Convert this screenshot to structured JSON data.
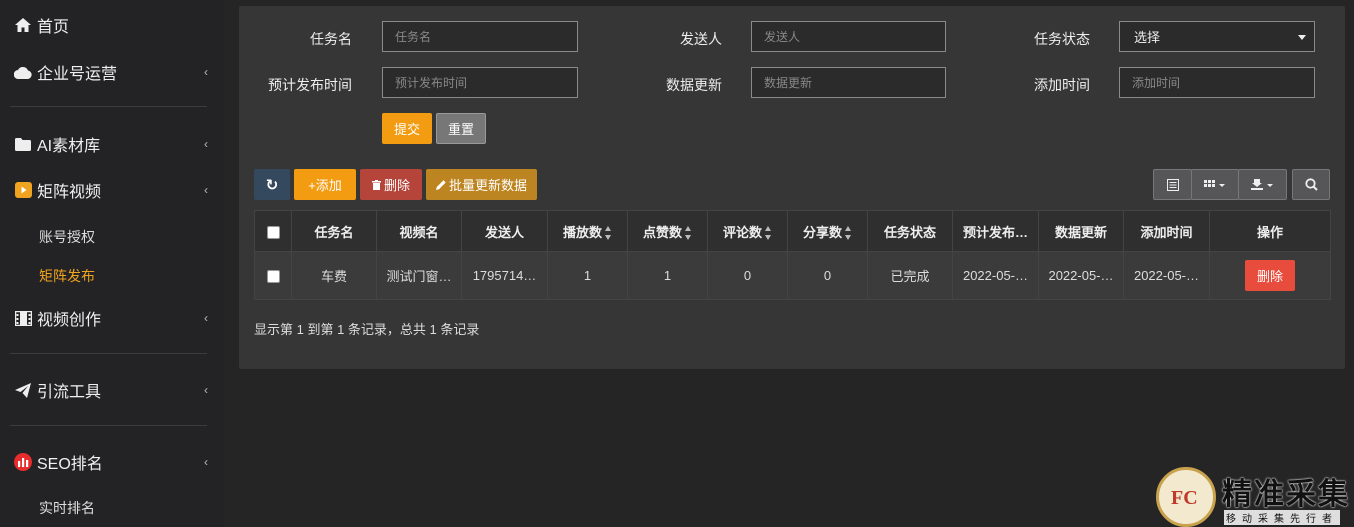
{
  "sidebar": {
    "home": "首页",
    "enterprise": "企业号运营",
    "ai_material": "AI素材库",
    "matrix_video": "矩阵视频",
    "account_auth": "账号授权",
    "matrix_publish": "矩阵发布",
    "video_create": "视频创作",
    "traffic_tools": "引流工具",
    "seo_rank": "SEO排名",
    "realtime_rank": "实时排名"
  },
  "filters": {
    "task_name_label": "任务名",
    "task_name_placeholder": "任务名",
    "sender_label": "发送人",
    "sender_placeholder": "发送人",
    "task_status_label": "任务状态",
    "task_status_value": "选择",
    "plan_time_label": "预计发布时间",
    "plan_time_placeholder": "预计发布时间",
    "data_update_label": "数据更新",
    "data_update_placeholder": "数据更新",
    "add_time_label": "添加时间",
    "add_time_placeholder": "添加时间",
    "submit": "提交",
    "reset": "重置"
  },
  "toolbar": {
    "refresh_icon": "↻",
    "add": "+添加",
    "delete": "删除",
    "batch_update": "批量更新数据"
  },
  "table": {
    "headers": [
      "任务名",
      "视频名",
      "发送人",
      "播放数",
      "点赞数",
      "评论数",
      "分享数",
      "任务状态",
      "预计发布…",
      "数据更新",
      "添加时间",
      "操作"
    ],
    "rows": [
      {
        "task_name": "车费",
        "video_name": "测试门窗…",
        "sender": "1795714…",
        "plays": "1",
        "likes": "1",
        "comments": "0",
        "shares": "0",
        "status": "已完成",
        "plan_time": "2022-05-…",
        "data_update": "2022-05-…",
        "add_time": "2022-05-…",
        "action": "删除"
      }
    ]
  },
  "footer": "显示第 1 到第 1 条记录，总共 1 条记录",
  "watermark": {
    "title": "精准采集",
    "subtitle": "移动采集先行者",
    "logo_text": "FC"
  },
  "colors": {
    "accent": "#f39c12",
    "active_menu": "#f0a31f",
    "danger": "#e74c3c"
  }
}
